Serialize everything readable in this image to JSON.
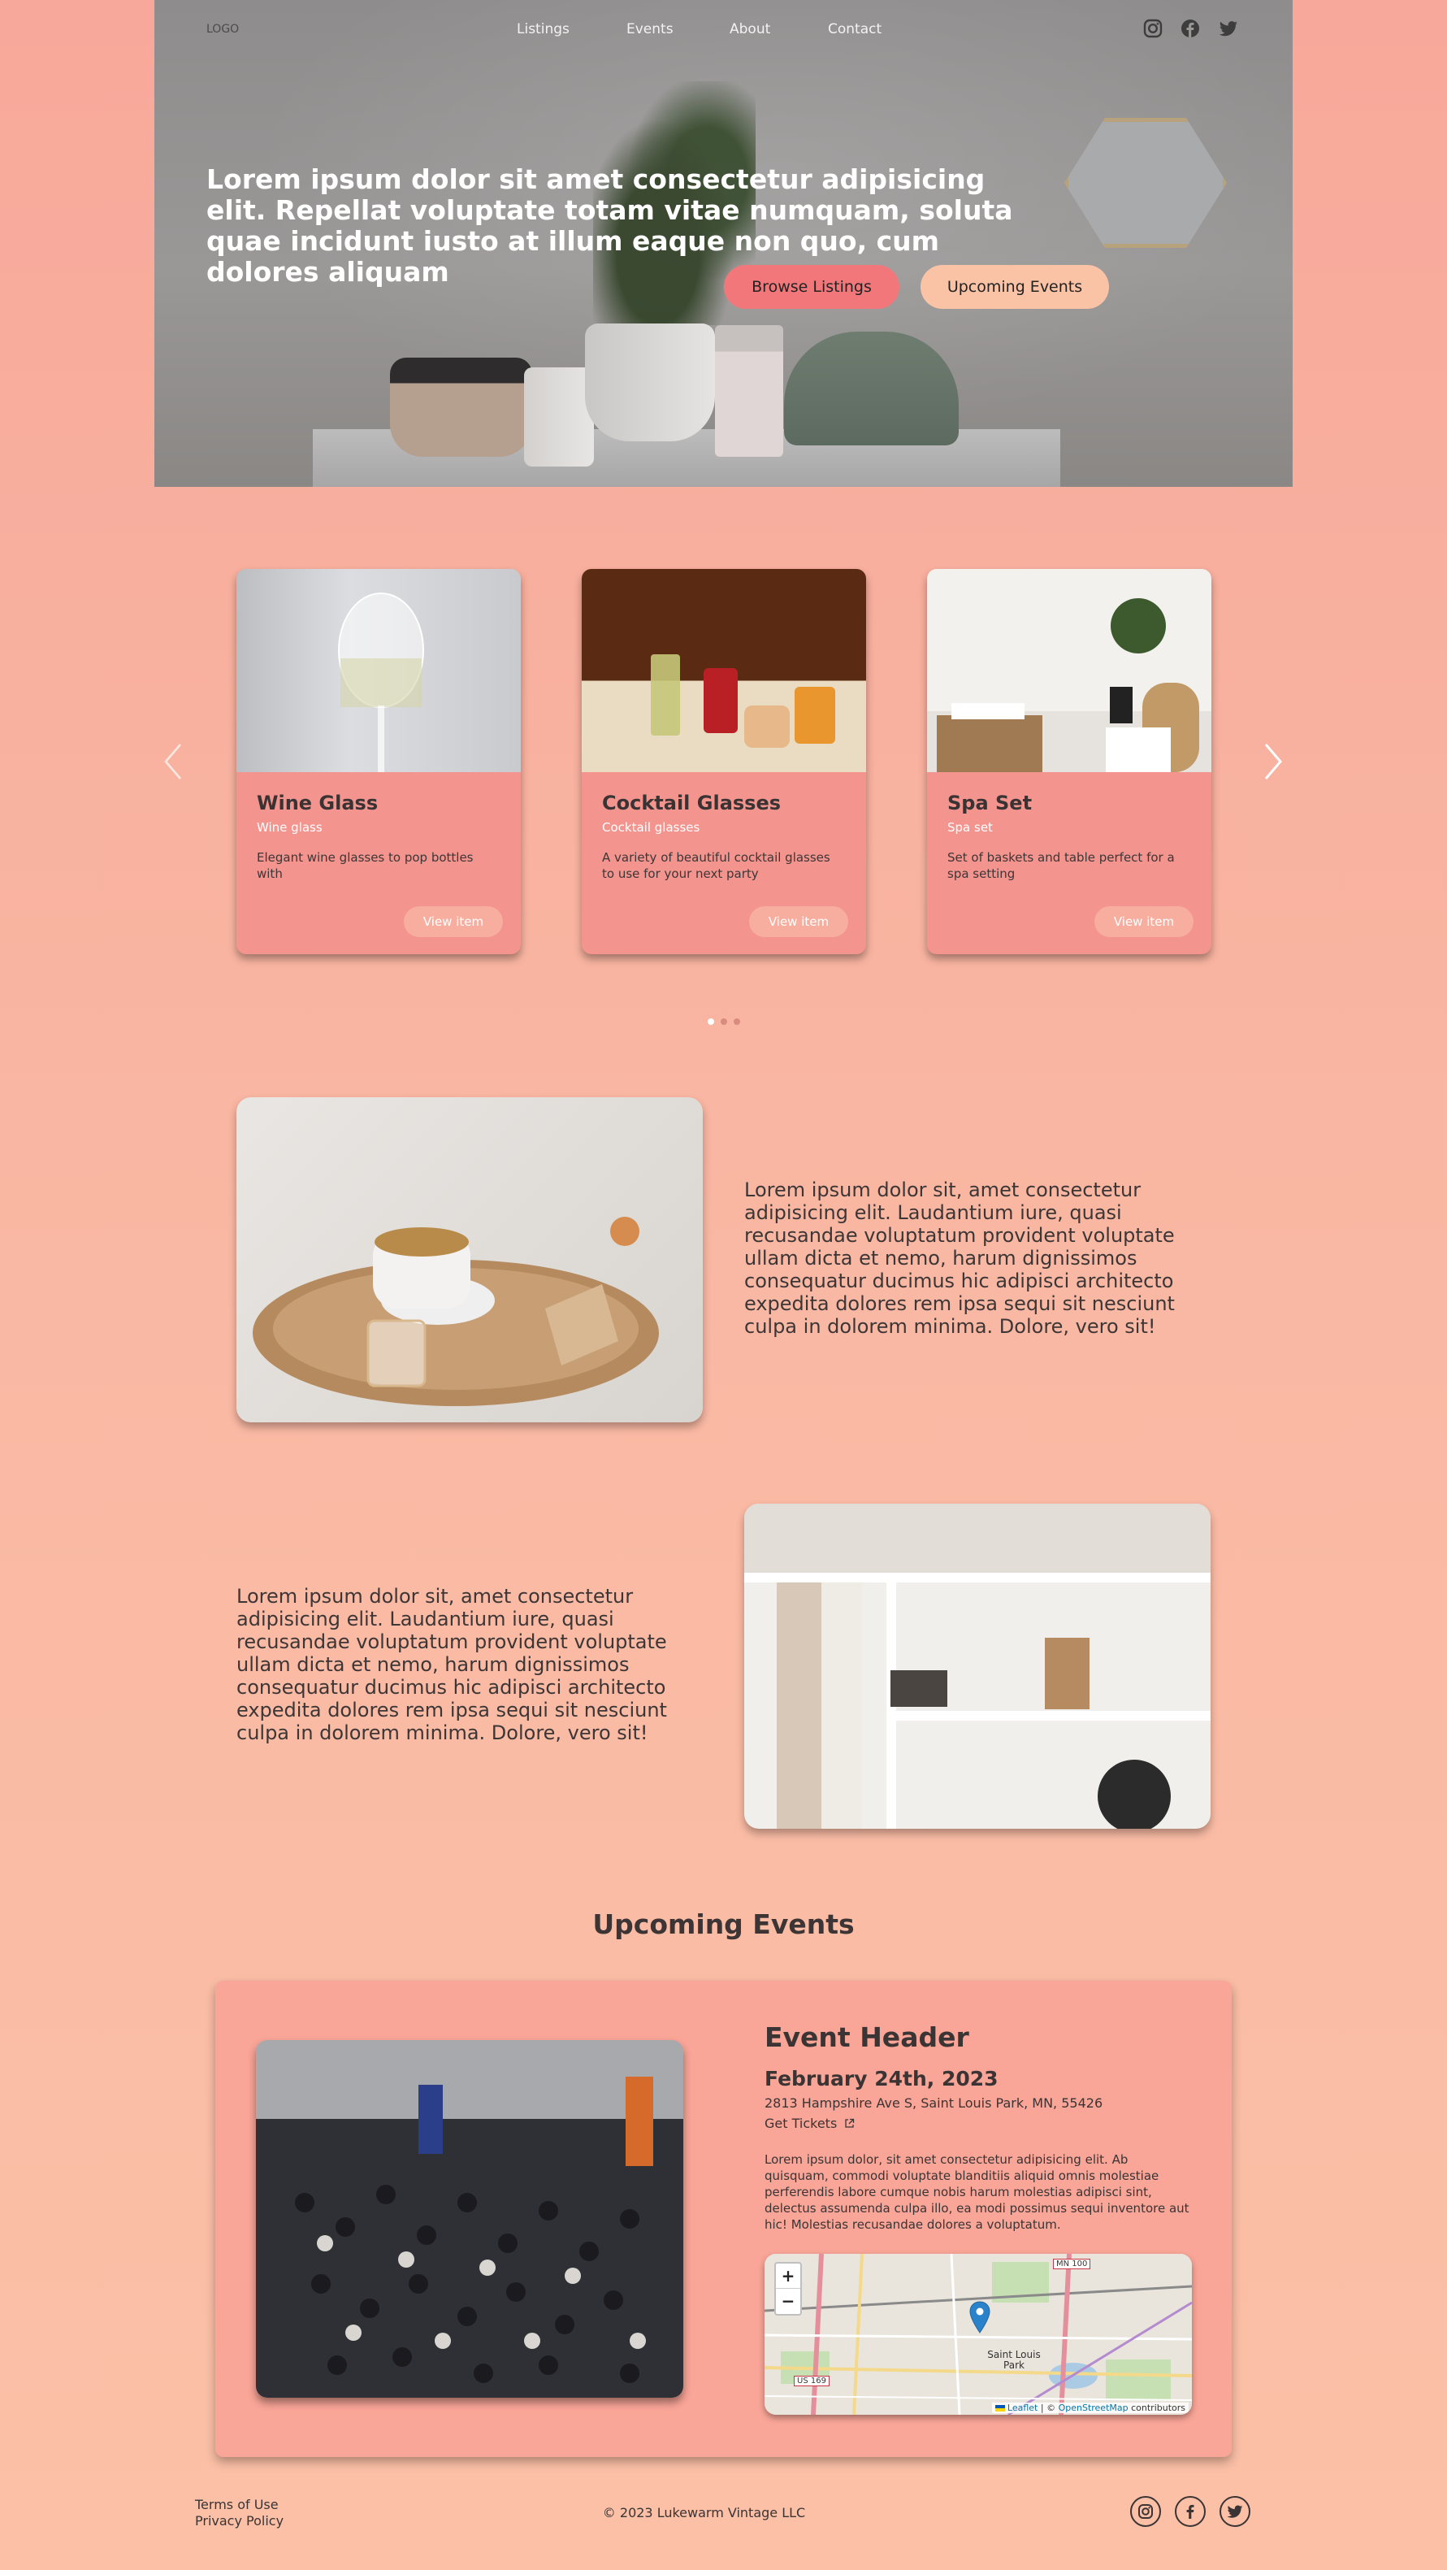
{
  "nav": {
    "logo": "LOGO",
    "links": [
      "Listings",
      "Events",
      "About",
      "Contact"
    ],
    "social_icons": [
      "instagram-icon",
      "facebook-icon",
      "twitter-icon"
    ]
  },
  "hero": {
    "headline": "Lorem ipsum dolor sit amet consectetur adipisicing elit. Repellat voluptate totam vitae numquam, soluta quae incidunt iusto at illum eaque non quo, cum dolores aliquam",
    "browse_label": "Browse Listings",
    "events_label": "Upcoming Events"
  },
  "carousel": {
    "cards": [
      {
        "title": "Wine Glass",
        "subtitle": "Wine glass",
        "description": "Elegant wine glasses to pop bottles with",
        "button": "View item"
      },
      {
        "title": "Cocktail Glasses",
        "subtitle": "Cocktail glasses",
        "description": "A variety of beautiful cocktail glasses to use for your next party",
        "button": "View item"
      },
      {
        "title": "Spa Set",
        "subtitle": "Spa set",
        "description": "Set of baskets and table perfect for a spa setting",
        "button": "View item"
      }
    ],
    "active_dot": 0,
    "dot_count": 3
  },
  "features": {
    "text_1": "Lorem ipsum dolor sit, amet consectetur adipisicing elit. Laudantium iure, quasi recusandae voluptatum provident voluptate ullam dicta et nemo, harum dignissimos consequatur ducimus hic adipisci architecto expedita dolores rem ipsa sequi sit nesciunt culpa in dolorem minima. Dolore, vero sit!",
    "text_2": "Lorem ipsum dolor sit, amet consectetur adipisicing elit. Laudantium iure, quasi recusandae voluptatum provident voluptate ullam dicta et nemo, harum dignissimos consequatur ducimus hic adipisci architecto expedita dolores rem ipsa sequi sit nesciunt culpa in dolorem minima. Dolore, vero sit!"
  },
  "events": {
    "heading": "Upcoming Events",
    "header": "Event Header",
    "date": "February 24th, 2023",
    "address": "2813 Hampshire Ave S, Saint Louis Park, MN, 55426",
    "tickets": "Get Tickets",
    "description": "Lorem ipsum dolor, sit amet consectetur adipisicing elit. Ab quisquam, commodi voluptate blanditiis aliquid omnis molestiae perferendis labore cumque nobis harum molestias adipisci sint, delectus assumenda culpa illo, ea modi possimus sequi inventore aut hic! Molestias recusandae dolores a voluptatum.",
    "map": {
      "zoom_in": "+",
      "zoom_out": "−",
      "place_label": "Saint Louis Park",
      "road_label_1": "MN 100",
      "road_label_2": "US 169",
      "attribution_leaflet": "Leaflet",
      "attribution_sep": " | © ",
      "attribution_osm": "OpenStreetMap",
      "attribution_tail": " contributors"
    }
  },
  "footer": {
    "terms": "Terms of Use",
    "privacy": "Privacy Policy",
    "copyright": "© 2023 Lukewarm Vintage LLC"
  },
  "colors": {
    "accent": "#f2777a",
    "card": "#f3948e",
    "secondary": "#fbc3a6"
  }
}
